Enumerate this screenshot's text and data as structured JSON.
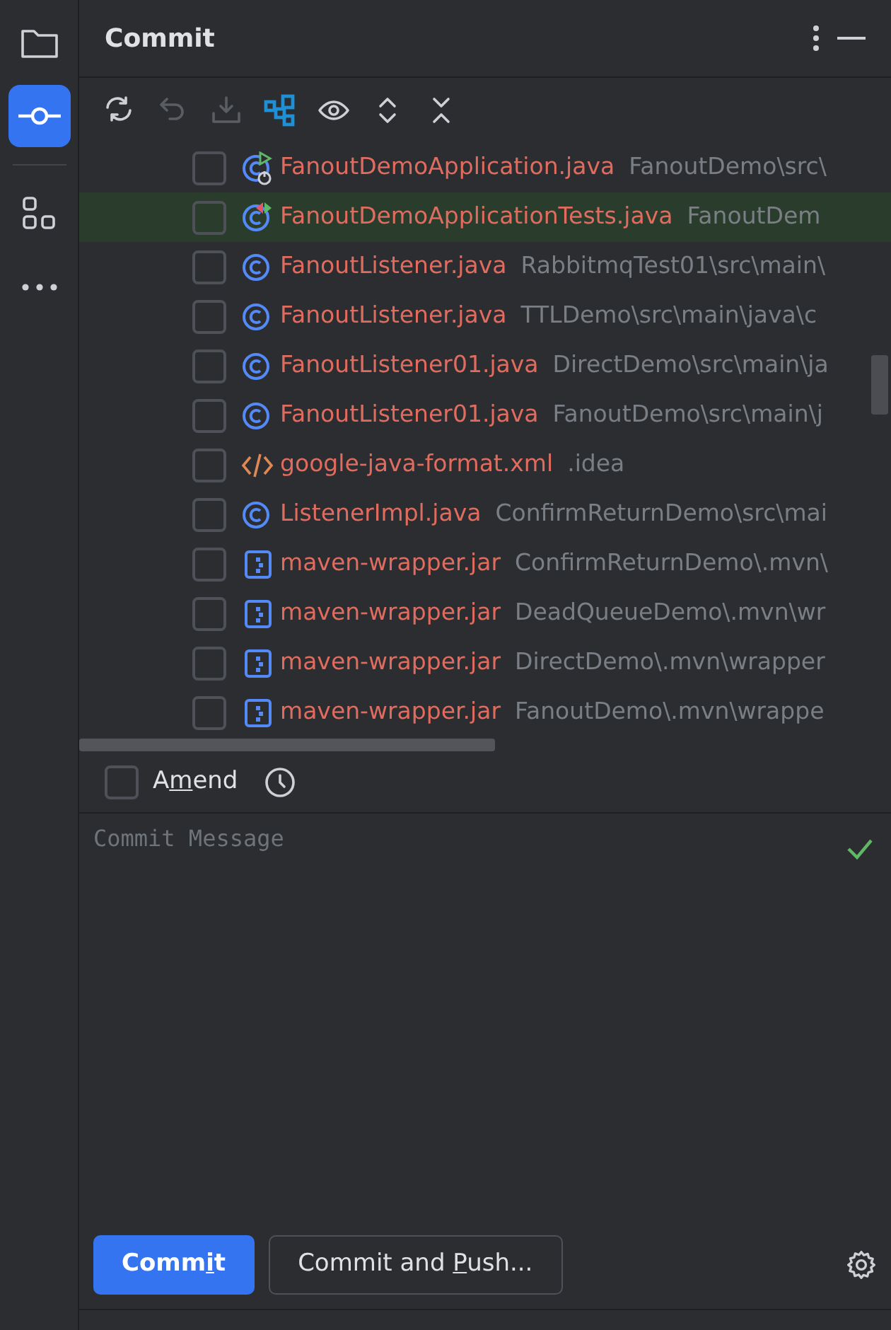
{
  "sidebar": {
    "items": [
      {
        "kind": "folder",
        "selected": false
      },
      {
        "kind": "commit",
        "selected": true
      },
      {
        "kind": "divider"
      },
      {
        "kind": "structure",
        "selected": false
      },
      {
        "kind": "more",
        "selected": false
      }
    ]
  },
  "panel": {
    "title": "Commit"
  },
  "toolbar": [
    {
      "kind": "refresh",
      "disabled": false
    },
    {
      "kind": "rollback",
      "disabled": true
    },
    {
      "kind": "shelve",
      "disabled": true
    },
    {
      "kind": "group",
      "disabled": false
    },
    {
      "kind": "view",
      "disabled": false
    },
    {
      "kind": "expand",
      "disabled": false
    },
    {
      "kind": "collapse",
      "disabled": false
    }
  ],
  "files": [
    {
      "kind": "class-run",
      "name": "FanoutDemoApplication.java",
      "path": "FanoutDemo\\src\\",
      "checked": false,
      "selected": false
    },
    {
      "kind": "class-test",
      "name": "FanoutDemoApplicationTests.java",
      "path": "FanoutDem",
      "checked": false,
      "selected": true
    },
    {
      "kind": "class",
      "name": "FanoutListener.java",
      "path": "RabbitmqTest01\\src\\main\\",
      "checked": false,
      "selected": false
    },
    {
      "kind": "class",
      "name": "FanoutListener.java",
      "path": "TTLDemo\\src\\main\\java\\c",
      "checked": false,
      "selected": false
    },
    {
      "kind": "class",
      "name": "FanoutListener01.java",
      "path": "DirectDemo\\src\\main\\ja",
      "checked": false,
      "selected": false
    },
    {
      "kind": "class",
      "name": "FanoutListener01.java",
      "path": "FanoutDemo\\src\\main\\j",
      "checked": false,
      "selected": false
    },
    {
      "kind": "xml",
      "name": "google-java-format.xml",
      "path": ".idea",
      "checked": false,
      "selected": false
    },
    {
      "kind": "class",
      "name": "ListenerImpl.java",
      "path": "ConfirmReturnDemo\\src\\mai",
      "checked": false,
      "selected": false
    },
    {
      "kind": "jar",
      "name": "maven-wrapper.jar",
      "path": "ConfirmReturnDemo\\.mvn\\",
      "checked": false,
      "selected": false
    },
    {
      "kind": "jar",
      "name": "maven-wrapper.jar",
      "path": "DeadQueueDemo\\.mvn\\wr",
      "checked": false,
      "selected": false
    },
    {
      "kind": "jar",
      "name": "maven-wrapper.jar",
      "path": "DirectDemo\\.mvn\\wrapper",
      "checked": false,
      "selected": false
    },
    {
      "kind": "jar",
      "name": "maven-wrapper.jar",
      "path": "FanoutDemo\\.mvn\\wrappe",
      "checked": false,
      "selected": false
    }
  ],
  "amend": {
    "label_parts": [
      "A",
      "m",
      "end"
    ],
    "checked": false
  },
  "message": {
    "placeholder": "Commit Message",
    "valid": true
  },
  "buttons": [
    {
      "kind": "primary",
      "label_parts": [
        "Comm",
        "i",
        "t"
      ]
    },
    {
      "kind": "secondary",
      "label_parts": [
        "Commit and ",
        "P",
        "ush..."
      ]
    }
  ]
}
